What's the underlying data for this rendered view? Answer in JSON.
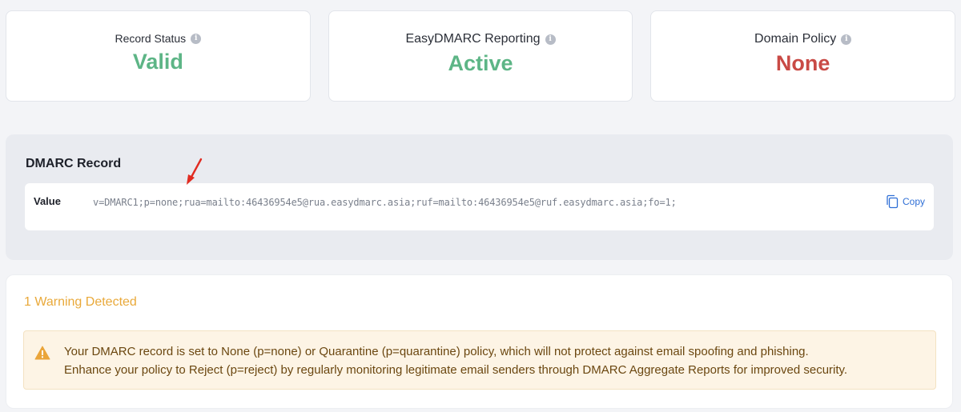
{
  "status_cards": [
    {
      "label": "Record Status",
      "value": "Valid"
    },
    {
      "label": "EasyDMARC Reporting",
      "value": "Active"
    },
    {
      "label": "Domain Policy",
      "value": "None"
    }
  ],
  "colors": {
    "valid": "#5db586",
    "active": "#5db586",
    "none": "#c94a45",
    "warning": "#e9a93a",
    "link": "#2f6fd6"
  },
  "dmarc_record": {
    "title": "DMARC Record",
    "value_label": "Value",
    "value": "v=DMARC1;p=none;rua=mailto:46436954e5@rua.easydmarc.asia;ruf=mailto:46436954e5@ruf.easydmarc.asia;fo=1;",
    "copy_label": "Copy"
  },
  "warnings": {
    "title": "1 Warning Detected",
    "messages": [
      "Your DMARC record is set to None (p=none) or Quarantine (p=quarantine) policy, which will not protect against email spoofing and phishing.",
      "Enhance your policy to Reject (p=reject) by regularly monitoring legitimate email senders through DMARC Aggregate Reports for improved security."
    ]
  },
  "icons": {
    "info": "info-icon",
    "copy": "copy-icon",
    "warning": "warning-triangle-icon",
    "annotation": "red-arrow-icon"
  }
}
